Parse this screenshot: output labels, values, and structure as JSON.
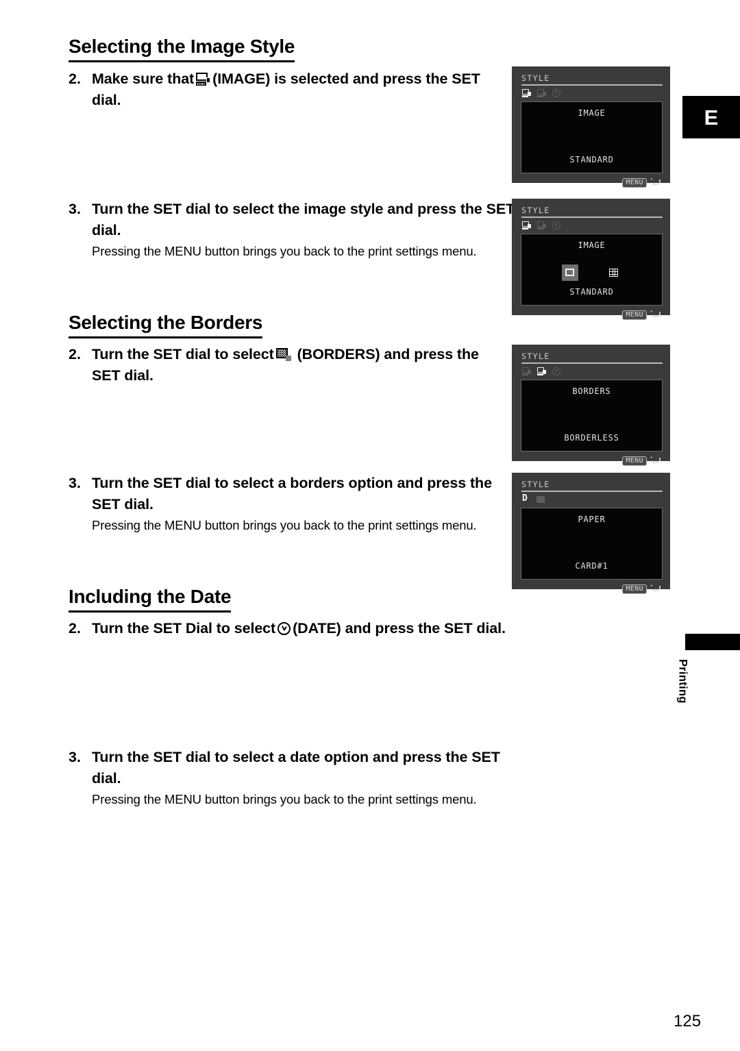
{
  "page": {
    "number": "125",
    "edge_tab_letter": "E",
    "side_label": "Printing"
  },
  "sections": [
    {
      "heading": "Selecting the Image Style",
      "steps": [
        {
          "number": "2.",
          "title_before": "Make sure that",
          "icon": "image-icon",
          "title_after": "(IMAGE) is selected and press the SET dial.",
          "note": ""
        },
        {
          "number": "3.",
          "title_before": "Turn the SET dial to select the image style and press the SET dial.",
          "icon": "",
          "title_after": "",
          "note": "Pressing the MENU button brings you back to the print settings menu."
        }
      ]
    },
    {
      "heading": "Selecting the Borders",
      "steps": [
        {
          "number": "2.",
          "title_before": "Turn the SET dial to select",
          "icon": "borders-icon",
          "title_after": "(BORDERS) and press the SET dial.",
          "note": ""
        },
        {
          "number": "3.",
          "title_before": "Turn the SET dial to select a borders option and press the SET dial.",
          "icon": "",
          "title_after": "",
          "note": "Pressing the MENU button brings you back to the print settings menu."
        }
      ]
    },
    {
      "heading": "Including the Date",
      "steps": [
        {
          "number": "2.",
          "title_before": "Turn the SET Dial to select",
          "icon": "date-clock-icon",
          "title_after": "(DATE) and press the SET dial.",
          "note": ""
        },
        {
          "number": "3.",
          "title_before": "Turn the SET dial to select a date option and press the SET dial.",
          "icon": "",
          "title_after": "",
          "note": "Pressing the MENU button brings you back to the print settings menu."
        }
      ]
    }
  ],
  "screens": [
    {
      "title": "STYLE",
      "item": "IMAGE",
      "value": "STANDARD",
      "menu_button": "MENU",
      "tabs": [
        "image-tab-selected",
        "borders-tab-dim",
        "date-tab-dim"
      ],
      "options": []
    },
    {
      "title": "STYLE",
      "item": "IMAGE",
      "value": "STANDARD",
      "menu_button": "MENU",
      "tabs": [
        "image-tab-selected",
        "borders-tab-dim",
        "date-tab-dim"
      ],
      "options": [
        "single-frame-option-selected",
        "grid-frame-option"
      ]
    },
    {
      "title": "STYLE",
      "item": "BORDERS",
      "value": "BORDERLESS",
      "menu_button": "MENU",
      "tabs": [
        "image-tab-dim",
        "borders-tab-selected",
        "date-tab-dim"
      ],
      "options": []
    },
    {
      "title": "STYLE",
      "item": "PAPER",
      "value": "CARD#1",
      "menu_button": "MENU",
      "tabs": [
        "paper-tab-selected",
        "second-tab-dim"
      ],
      "options": []
    }
  ]
}
